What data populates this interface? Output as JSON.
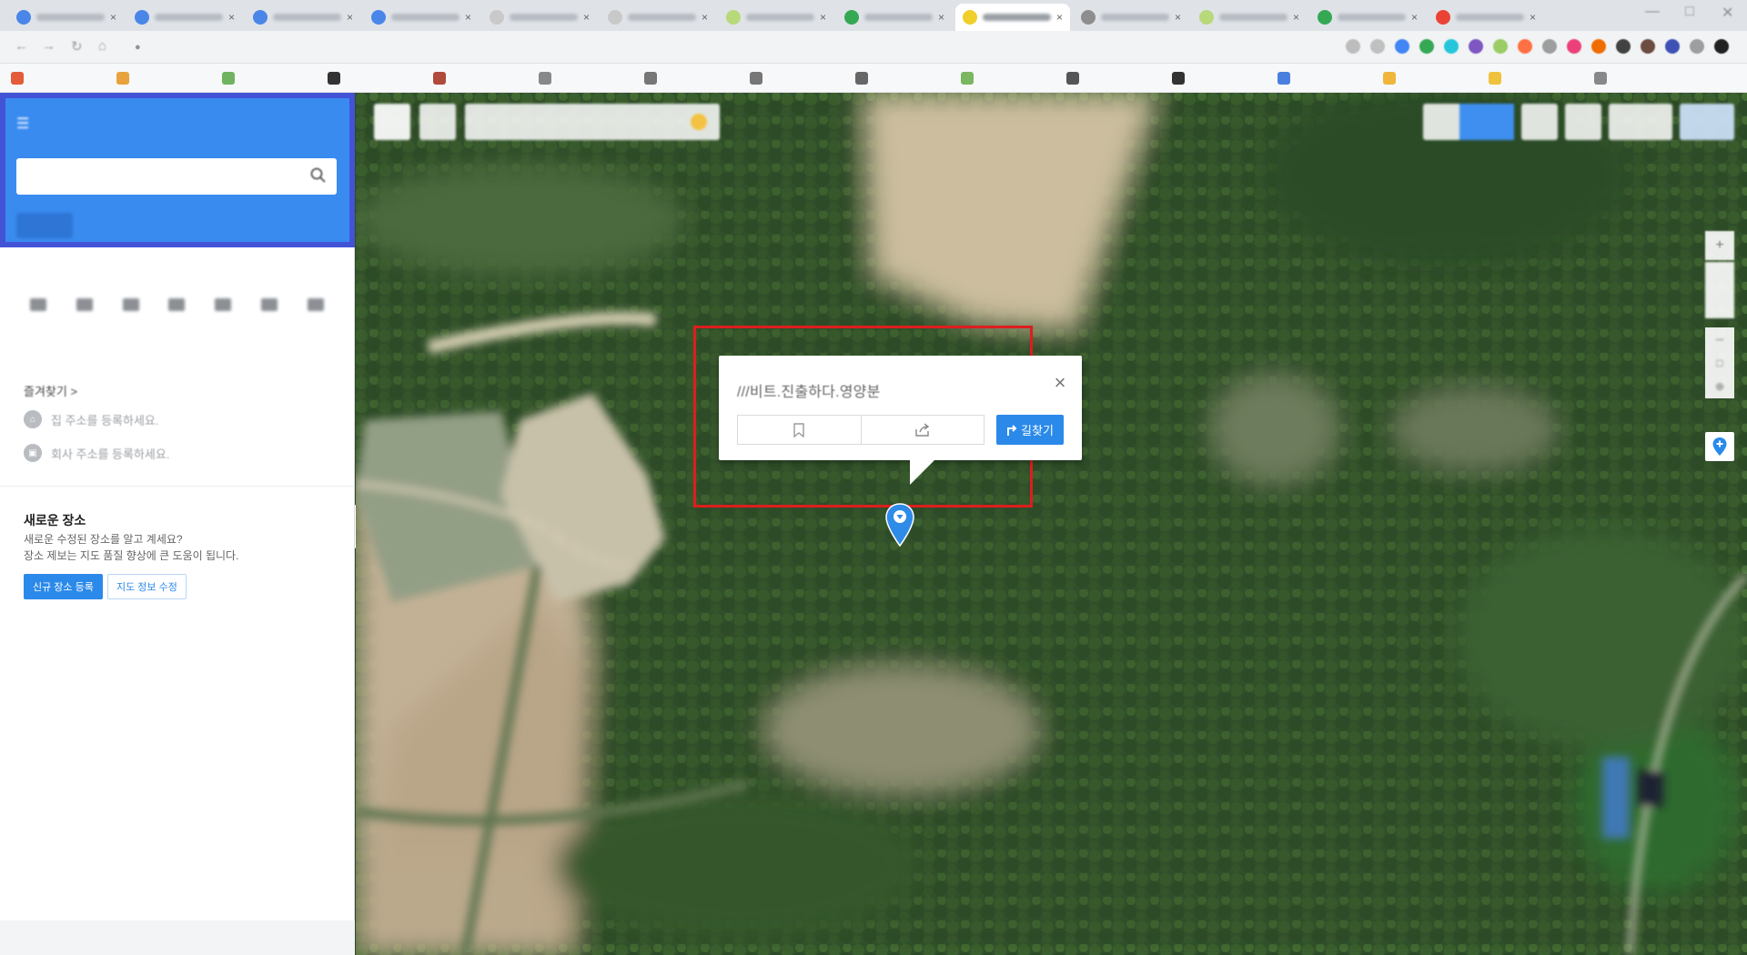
{
  "browser": {
    "tabs": [
      {
        "title": "",
        "favicon_color": "#4a86e8"
      },
      {
        "title": "",
        "favicon_color": "#4a86e8"
      },
      {
        "title": "",
        "favicon_color": "#4a86e8"
      },
      {
        "title": "",
        "favicon_color": "#4a86e8"
      },
      {
        "title": "",
        "favicon_color": "#c9c9c9"
      },
      {
        "title": "",
        "favicon_color": "#c9c9c9"
      },
      {
        "title": "",
        "favicon_color": "#b7d97a"
      },
      {
        "title": "",
        "favicon_color": "#34a853"
      },
      {
        "title": "",
        "favicon_color": "#f0cf2a",
        "active": true
      },
      {
        "title": "",
        "favicon_color": "#8e8e8e"
      },
      {
        "title": "",
        "favicon_color": "#b7d97a"
      },
      {
        "title": "",
        "favicon_color": "#34a853"
      },
      {
        "title": "",
        "favicon_color": "#ea4335"
      }
    ],
    "url": "",
    "bookmarks": [
      "",
      "",
      "",
      "",
      "",
      "",
      "",
      "",
      "",
      "",
      "",
      "",
      "",
      "",
      "",
      ""
    ],
    "extension_colors": [
      "#bdbdbd",
      "#c0c0c0",
      "#4285f4",
      "#34a853",
      "#26c6da",
      "#7e57c2",
      "#9ccc65",
      "#ff7043",
      "#9e9e9e",
      "#ec407a",
      "#ef6c00",
      "#424242",
      "#6d4c41",
      "#3f51b5",
      "#9e9e9e",
      "#212121"
    ]
  },
  "panel": {
    "header_title": "",
    "header_right": "",
    "search_value": "",
    "tabs": [
      "",
      "",
      "",
      "",
      ""
    ],
    "recent_label": "",
    "recent_items": [
      "",
      "",
      "",
      "",
      "",
      "",
      ""
    ],
    "favorites_title": "즐겨찾기 >",
    "home_hint": "집 주소를 등록하세요.",
    "work_hint": "회사 주소를 등록하세요.",
    "new_place_title": "새로운 장소",
    "new_place_desc_1": "새로운 수정된 장소를 알고 계세요?",
    "new_place_desc_2": "장소 제보는 지도 품질 향상에 큰 도움이 됩니다.",
    "register_button": "신규 장소 등록",
    "edit_button": "지도 정보 수정",
    "footer_links": [
      "",
      "",
      ""
    ]
  },
  "map": {
    "weather_text": "",
    "popup_address": "///비트.진출하다.영양분",
    "route_button": "길찾기",
    "copyright": "",
    "accent_color": "#2b89ea",
    "highlight_color": "#dd1e1e"
  }
}
